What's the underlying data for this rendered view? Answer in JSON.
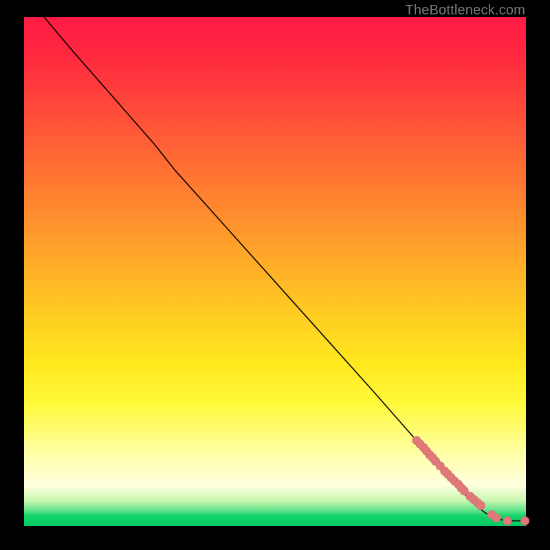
{
  "attribution": "TheBottleneck.com",
  "colors": {
    "marker": "#e07a7a",
    "curve": "#000000"
  },
  "chart_data": {
    "type": "line",
    "title": "",
    "xlabel": "",
    "ylabel": "",
    "xlim": [
      0,
      100
    ],
    "ylim": [
      0,
      100
    ],
    "grid": false,
    "legend": false,
    "note": "Axes unlabeled; values estimated from pixel positions on a 0–100 normalized scale (x left→right, y bottom→top).",
    "series": [
      {
        "name": "curve",
        "style": "line",
        "x": [
          4,
          10,
          18,
          26,
          30,
          40,
          50,
          60,
          70,
          78,
          84,
          88,
          90,
          92,
          94,
          96,
          98,
          100
        ],
        "y": [
          100,
          93,
          84,
          75,
          70,
          59,
          48,
          37,
          26,
          17,
          10,
          6,
          4,
          2.5,
          1.5,
          1,
          1,
          1
        ]
      },
      {
        "name": "markers",
        "style": "scatter",
        "x": [
          78.2,
          78.9,
          79.6,
          80.2,
          80.8,
          81.4,
          82.0,
          82.9,
          83.8,
          84.4,
          85.1,
          85.8,
          86.5,
          87.1,
          87.7,
          88.9,
          89.6,
          90.3,
          91.0,
          93.2,
          94.1,
          96.3,
          99.8
        ],
        "y": [
          16.8,
          16.1,
          15.4,
          14.7,
          14.0,
          13.4,
          12.7,
          11.8,
          10.8,
          10.2,
          9.5,
          8.8,
          8.2,
          7.5,
          6.9,
          5.8,
          5.2,
          4.6,
          4.0,
          2.2,
          1.6,
          1.0,
          1.0
        ]
      }
    ]
  }
}
